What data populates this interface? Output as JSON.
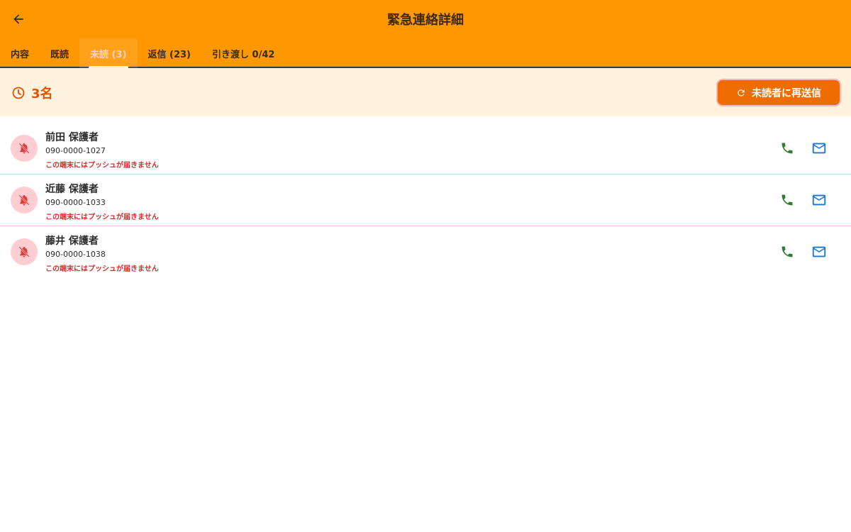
{
  "header": {
    "title": "緊急連絡詳細",
    "back_icon": "arrow-left-icon"
  },
  "tabs": [
    {
      "label": "内容",
      "active": false
    },
    {
      "label": "既読",
      "active": false
    },
    {
      "label": "未読 (3)",
      "active": true
    },
    {
      "label": "返信 (23)",
      "active": false
    },
    {
      "label": "引き渡し 0/42",
      "active": false
    }
  ],
  "summary": {
    "icon": "clock-icon",
    "count_text": "3名",
    "resend_icon": "refresh-icon",
    "resend_label": "未読者に再送信"
  },
  "recipients": [
    {
      "name": "前田 保護者",
      "phone": "090-0000-1027",
      "warning": "この端末にはプッシュが届きません"
    },
    {
      "name": "近藤 保護者",
      "phone": "090-0000-1033",
      "warning": "この端末にはプッシュが届きません"
    },
    {
      "name": "藤井 保護者",
      "phone": "090-0000-1038",
      "warning": "この端末にはプッシュが届きません"
    }
  ],
  "colors": {
    "app_bar": "#ff9800",
    "summary_bg": "#fff3e0",
    "accent": "#e65100",
    "resend_button": "#ef6c00",
    "warning": "#d32f2f",
    "call": "#2e7d32",
    "mail": "#1976d2"
  }
}
